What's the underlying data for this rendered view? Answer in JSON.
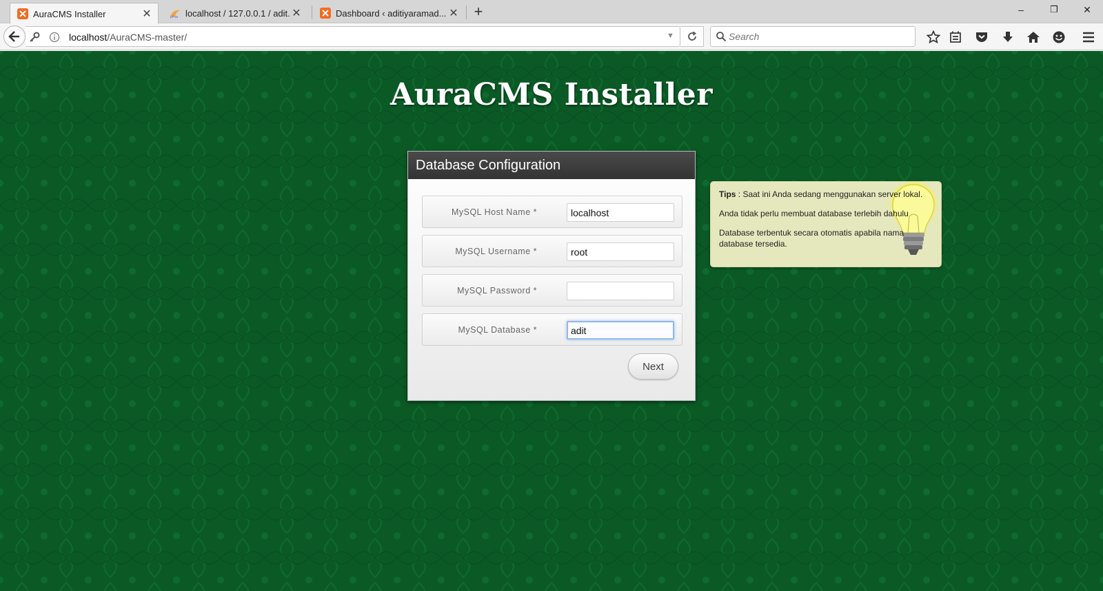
{
  "browser": {
    "tabs": [
      {
        "title": "AuraCMS Installer",
        "icon": "xampp-icon",
        "active": true
      },
      {
        "title": "localhost / 127.0.0.1 / adit...",
        "icon": "phpmyadmin-icon",
        "active": false
      },
      {
        "title": "Dashboard ‹ aditiyaramad...",
        "icon": "xampp-icon",
        "active": false
      }
    ],
    "new_tab": "+",
    "window": {
      "minimize": "–",
      "restore": "❐",
      "close": "✕"
    },
    "url": {
      "host": "localhost",
      "path": "/AuraCMS-master/"
    },
    "search_placeholder": "Search"
  },
  "page": {
    "title": "AuraCMS Installer",
    "background_color": "#0b5a26",
    "panel": {
      "heading": "Database Configuration",
      "fields": [
        {
          "label": "MySQL Host Name *",
          "value": "localhost"
        },
        {
          "label": "MySQL Username *",
          "value": "root"
        },
        {
          "label": "MySQL Password *",
          "value": ""
        },
        {
          "label": "MySQL Database *",
          "value": "adit"
        }
      ],
      "next_label": "Next"
    },
    "tips": {
      "label": "Tips",
      "line1": " : Saat ini Anda sedang menggunakan server lokal.",
      "line2": "Anda tidak perlu membuat database terlebih dahulu",
      "line3a": "Database terbentuk secara otomatis apabila nama",
      "line3b": "database tersedia."
    }
  }
}
